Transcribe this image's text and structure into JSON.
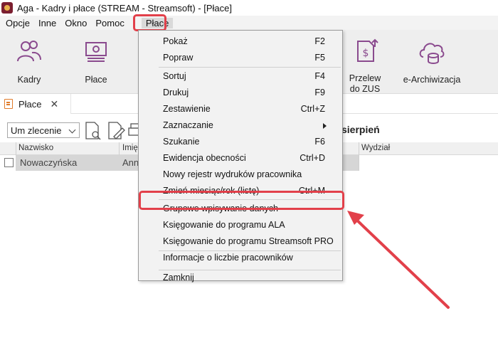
{
  "window": {
    "title": "Aga - Kadry i płace (STREAM - Streamsoft) - [Płace]"
  },
  "menubar": {
    "items": [
      "Opcje",
      "Inne",
      "Okno",
      "Pomoc",
      "Płace"
    ]
  },
  "ribbon": {
    "buttons": [
      {
        "label": "Kadry",
        "icon": "people-icon"
      },
      {
        "label": "Płace",
        "icon": "payroll-icon"
      },
      {
        "label": "Przelew do ZUS",
        "icon": "zus-transfer-icon"
      },
      {
        "label": "e-Archiwizacja",
        "icon": "cloud-database-icon"
      }
    ]
  },
  "tab": {
    "label": "Płace"
  },
  "toolbar": {
    "contract_select": "Um zlecenie",
    "month_partial": "sierpień"
  },
  "grid": {
    "headers": [
      "Nazwisko",
      "Imię",
      "Wydział"
    ],
    "rows": [
      {
        "surname": "Nowaczyńska",
        "firstname": "Ann"
      }
    ]
  },
  "dropdown": {
    "items": [
      {
        "label": "Pokaż",
        "shortcut": "F2"
      },
      {
        "label": "Popraw",
        "shortcut": "F5"
      },
      {
        "label": "Sortuj",
        "shortcut": "F4"
      },
      {
        "label": "Drukuj",
        "shortcut": "F9"
      },
      {
        "label": "Zestawienie",
        "shortcut": "Ctrl+Z"
      },
      {
        "label": "Zaznaczanie",
        "shortcut": ""
      },
      {
        "label": "Szukanie",
        "shortcut": "F6"
      },
      {
        "label": "Ewidencja obecności",
        "shortcut": "Ctrl+D"
      },
      {
        "label": "Nowy rejestr wydruków pracownika",
        "shortcut": ""
      },
      {
        "label": "Zmień miesiąc/rok (listę)",
        "shortcut": "Ctrl+M"
      },
      {
        "label": "Grupowe wpisywanie danych",
        "shortcut": ""
      },
      {
        "label": "Księgowanie do programu ALA",
        "shortcut": ""
      },
      {
        "label": "Księgowanie do programu Streamsoft PRO",
        "shortcut": ""
      },
      {
        "label": "Informacje o liczbie pracowników",
        "shortcut": ""
      },
      {
        "label": "Zamknij",
        "shortcut": ""
      }
    ]
  },
  "colors": {
    "highlight": "#e2404a",
    "accent_purple": "#8a4a8e"
  }
}
